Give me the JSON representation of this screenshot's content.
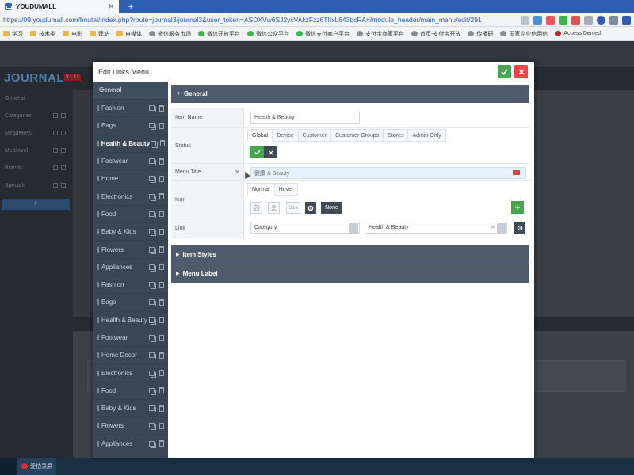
{
  "browser": {
    "tab_title": "YOUDUMALL",
    "url": "https://09.youdumall.com/houtai/index.php?route=journal3/journal3&user_token=ASDXVw6SJ2ycVAkzFzz6TIIxL643bcRA#/module_header/main_menu/edit/291",
    "bookmarks": [
      "学习",
      "技术类",
      "电影",
      "建站",
      "自媒体",
      "微信服务市场",
      "微信开放平台",
      "微信公众平台",
      "微信支付商户平台",
      "支付宝商家平台",
      "首页-支付宝开放",
      "传播研",
      "国家企业信用信",
      "Access Denied"
    ]
  },
  "background": {
    "logo": "JOURNAL",
    "version": "3.1.12",
    "nav": [
      "General",
      "Categories",
      "MegaMenu",
      "Multilevel",
      "Brands",
      "Specials"
    ],
    "plus": "+"
  },
  "taskbar": {
    "item": "爱拍录屏"
  },
  "modal": {
    "title": "Edit Links Menu",
    "sidebar_heading": "General",
    "sidebar_items": [
      {
        "label": "Fashion"
      },
      {
        "label": "Bags"
      },
      {
        "label": "Health & Beauty"
      },
      {
        "label": "Footwear"
      },
      {
        "label": "Home"
      },
      {
        "label": "Electronics"
      },
      {
        "label": "Food"
      },
      {
        "label": "Baby & Kids"
      },
      {
        "label": "Flowers"
      },
      {
        "label": "Appliances"
      },
      {
        "label": "Fashion"
      },
      {
        "label": "Bags"
      },
      {
        "label": "Health & Beauty"
      },
      {
        "label": "Footwear"
      },
      {
        "label": "Home Decor"
      },
      {
        "label": "Electronics"
      },
      {
        "label": "Food"
      },
      {
        "label": "Baby & Kids"
      },
      {
        "label": "Flowers"
      },
      {
        "label": "Appliances"
      }
    ],
    "active_index": 2,
    "sections": {
      "general": "General",
      "item_styles": "Item Styles",
      "menu_label": "Menu Label"
    },
    "form": {
      "item_name_label": "Item Name",
      "item_name_value": "Health & Beauty",
      "status_label": "Status",
      "status_tabs": [
        "Global",
        "Device",
        "Customer",
        "Customer Groups",
        "Stores",
        "Admin Only"
      ],
      "menu_title_label": "Menu Title",
      "menu_title_value": "健康 & Beauty",
      "icon_label": "Icon",
      "icon_tabs": [
        "Normal",
        "Hover"
      ],
      "icon_size": "Size",
      "icon_none": "None",
      "link_label": "Link",
      "link_type": "Category",
      "link_value": "Health & Beauty"
    }
  }
}
